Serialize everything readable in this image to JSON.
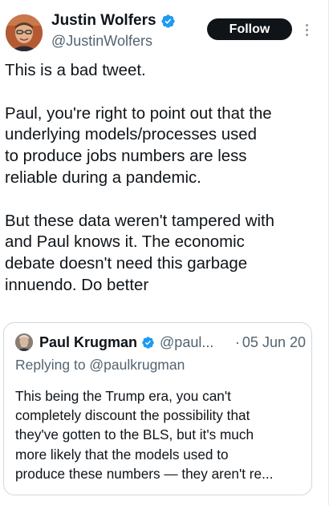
{
  "author": {
    "display_name": "Justin Wolfers",
    "handle": "@JustinWolfers",
    "verified": true,
    "avatar_icon": "avatar-photo"
  },
  "actions": {
    "follow_label": "Follow",
    "more_icon": "more-vertical-icon"
  },
  "tweet": {
    "paragraphs": [
      [
        "This is a bad tweet."
      ],
      [
        "Paul, you're right to point out that the",
        "underlying models/processes used",
        "to produce jobs numbers are less",
        "reliable during a pandemic."
      ],
      [
        "But these data weren't tampered with",
        "and Paul knows it. The economic",
        "debate doesn't need this garbage",
        "innuendo. Do better"
      ]
    ]
  },
  "quoted_tweet": {
    "display_name": "Paul Krugman",
    "handle": "@paul...",
    "separator": "·",
    "date": "05 Jun 20",
    "replying_to": "Replying to @paulkrugman",
    "text_lines": [
      "This being the Trump era, you can't",
      "completely discount the possibility that",
      "they've gotten to the BLS, but it's much",
      "more likely that the models used to",
      "produce these numbers — they aren't re..."
    ]
  },
  "colors": {
    "text": "#0f1419",
    "secondary": "#536471",
    "verified_blue": "#1d9bf0",
    "button_bg": "#0f1419",
    "border": "#cfd9de"
  }
}
